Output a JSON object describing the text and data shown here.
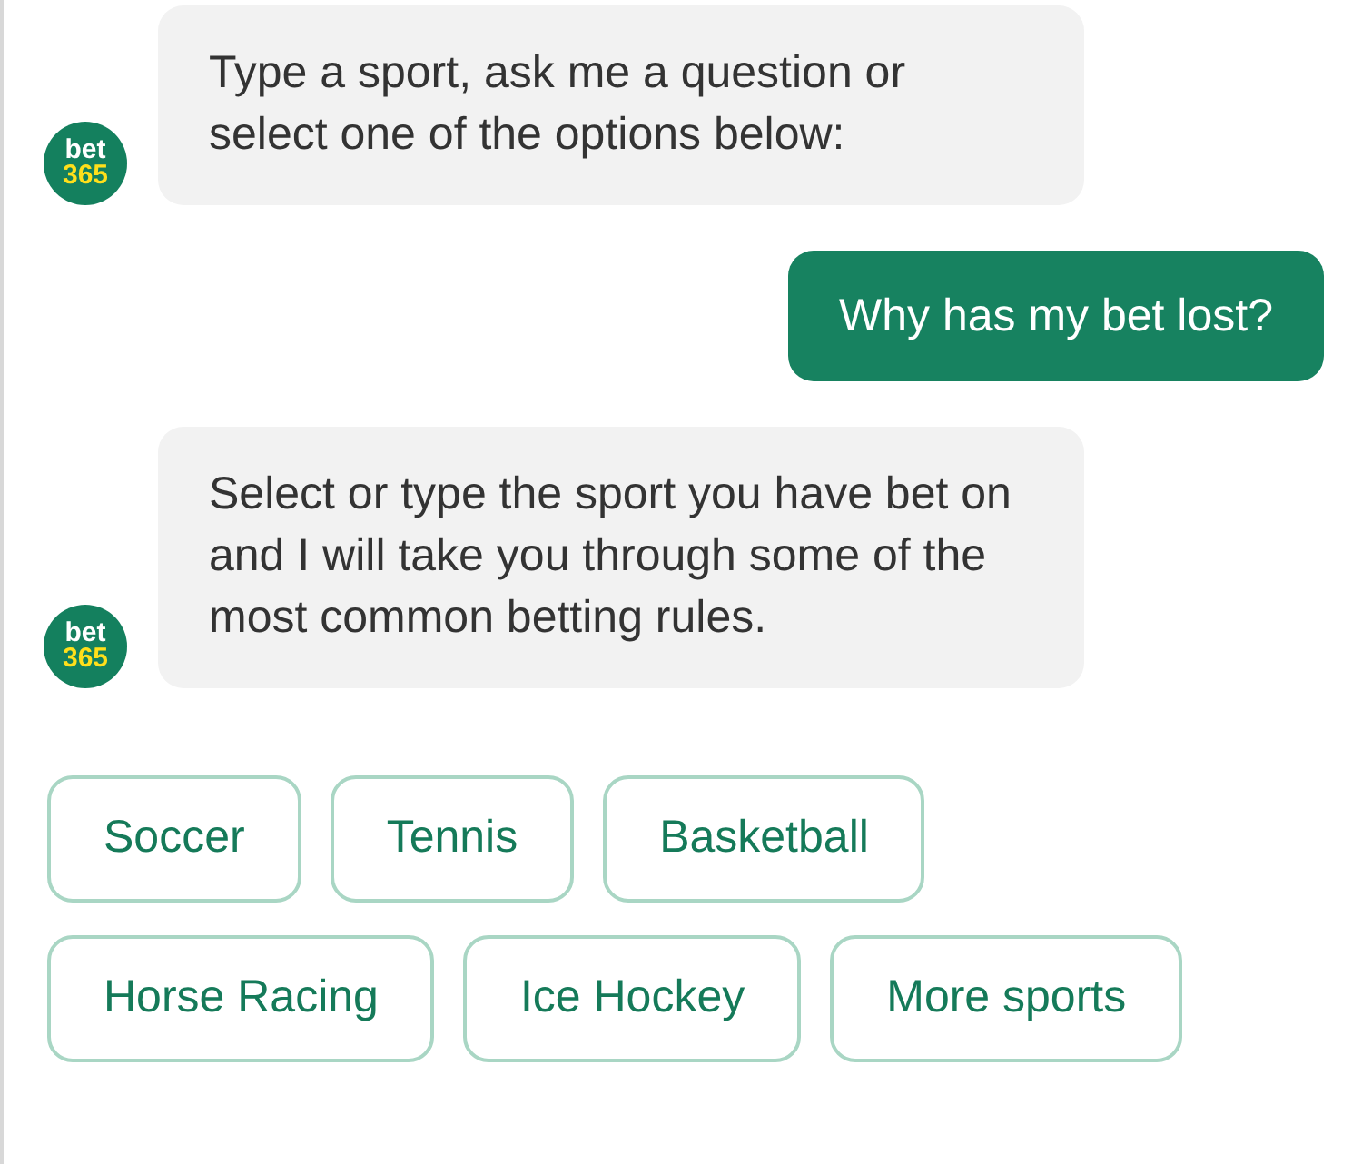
{
  "messages": [
    {
      "kind": "bot",
      "avatar": {
        "line_1": "bet",
        "line_2": "365"
      },
      "text": "Type a sport, ask me a question or select one of the options below:"
    },
    {
      "kind": "user",
      "text": "Why has my bet lost?"
    },
    {
      "kind": "bot",
      "avatar": {
        "line_1": "bet",
        "line_2": "365"
      },
      "text": "Select or type the sport you have bet on and I will take you through some of the most common betting rules."
    }
  ],
  "options": [
    [
      "Soccer",
      "Tennis",
      "Basketball"
    ],
    [
      "Horse Racing",
      "Ice Hockey",
      "More sports"
    ]
  ]
}
